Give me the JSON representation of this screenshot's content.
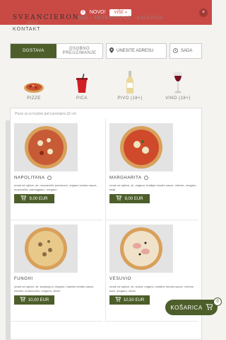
{
  "banner": {
    "label": "NOVO!",
    "more_label": "VIŠE »",
    "close": "×"
  },
  "header": {
    "logo": "SVEANCIERON",
    "logo_sub": "pizza",
    "nav_hint": "NAŠ · REZERVACIJE · GALERIJA",
    "kontakt": "KONTAKT"
  },
  "delivery": {
    "active": "DOSTAVA",
    "inactive": "OSOBNO PREUZIMANJE",
    "address_placeholder": "UNESITE ADRESU",
    "time": "SADA"
  },
  "categories": [
    {
      "label": "PIZZE",
      "icon": "pizza-icon"
    },
    {
      "label": "PIĆA",
      "icon": "cup-icon"
    },
    {
      "label": "PIVO (18+)",
      "icon": "beer-bottle-icon"
    },
    {
      "label": "VINO (18+)",
      "icon": "wine-glass-icon"
    }
  ],
  "grid": {
    "note": "Pizze su iz krušne peći promjera 32 cm",
    "items": [
      {
        "name": "NAPOLITANA",
        "desc": "umak od rajčice, sir, mozzarella, parmezan, origano tomato sauce, mozzarella, parmiggiano, oregano",
        "price": "9,00 EUR"
      },
      {
        "name": "MARGHARITA",
        "desc": "umak od rajčice, sir, origano, bosiljak tomato sauce, cheese, oregano, basil",
        "price": "9,00 EUR"
      },
      {
        "name": "FUNGHI",
        "desc": "umak od rajčice, sir, šampinjoni, origano, masline tomato sauce, cheese, mushrooms, oregano, olives",
        "price": "10,00 EUR"
      },
      {
        "name": "VESUVIO",
        "desc": "umak od rajčice, sir, šunka, origano, masline tomato sauce, cheese, ham, oregano, olives",
        "price": "10,50 EUR"
      }
    ]
  },
  "cart": {
    "label": "KOŠARICA",
    "count": "0",
    "icon": "cart-icon"
  },
  "colors": {
    "accent": "#4d5e2a",
    "banner": "#c94a45"
  }
}
